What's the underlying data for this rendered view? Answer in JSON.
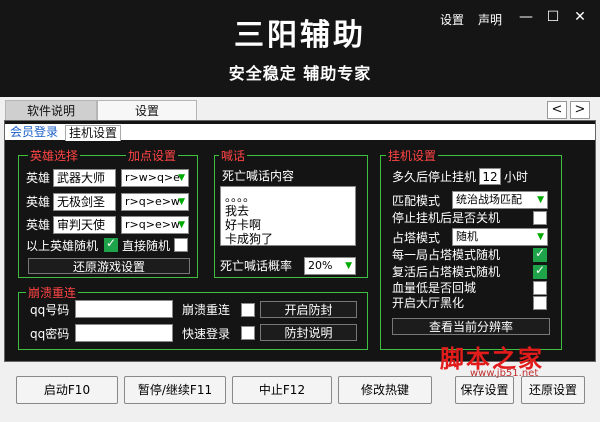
{
  "header": {
    "title": "三阳辅助",
    "subtitle": "安全稳定 辅助专家",
    "settings_link": "设置",
    "statement_link": "声明",
    "minimize": "—",
    "maximize": "☐",
    "close": "✕"
  },
  "top_tabs": [
    "软件说明",
    "设置"
  ],
  "top_arrows": {
    "left": "<",
    "right": ">"
  },
  "sub_tabs": [
    "会员登录",
    "挂机设置"
  ],
  "hero": {
    "title": "英雄选择",
    "points_title": "加点设置",
    "rows": [
      {
        "label": "英雄",
        "name": "武器大师",
        "points": "r>w>q>e"
      },
      {
        "label": "英雄",
        "name": "无极剑圣",
        "points": "r>q>e>w"
      },
      {
        "label": "英雄",
        "name": "审判天使",
        "points": "r>q>e>w"
      }
    ],
    "random_above_label": "以上英雄随机",
    "direct_random_label": "直接随机",
    "restore_btn": "还原游戏设置"
  },
  "shout": {
    "title": "喊话",
    "death_label": "死亡喊话内容",
    "content": "。。。。\n我去\n好卡啊\n卡成狗了",
    "prob_label": "死亡喊话概率",
    "prob_value": "20%"
  },
  "crash": {
    "title": "崩溃重连",
    "qq_label": "qq号码",
    "pwd_label": "qq密码",
    "reconnect_label": "崩溃重连",
    "quick_login_label": "快速登录",
    "anti_seal_btn": "开启防封",
    "anti_seal_info_btn": "防封说明"
  },
  "hang": {
    "title": "挂机设置",
    "stop_after_prefix": "多久后停止挂机",
    "stop_after_value": "12",
    "stop_after_unit": "小时",
    "match_label": "匹配模式",
    "match_value": "统治战场匹配",
    "shutdown_label": "停止挂机后是否关机",
    "tower_label": "占塔模式",
    "tower_value": "随机",
    "each_round_label": "每一局占塔模式随机",
    "revive_label": "复活后占塔模式随机",
    "low_hp_label": "血量低是否回城",
    "blackout_label": "开启大厅黑化",
    "view_ratio_btn": "查看当前分辨率"
  },
  "bottom_buttons": [
    "启动F10",
    "暂停/继续F11",
    "中止F12",
    "修改热键",
    "保存设置",
    "还原设置"
  ],
  "watermark": {
    "text": "脚本之家",
    "url": "www.jb51.net"
  },
  "colors": {
    "accent_green": "#3fbf3f",
    "title_red": "#ff4444",
    "check_green": "#1fa34a",
    "panel_bg": "#141414"
  }
}
